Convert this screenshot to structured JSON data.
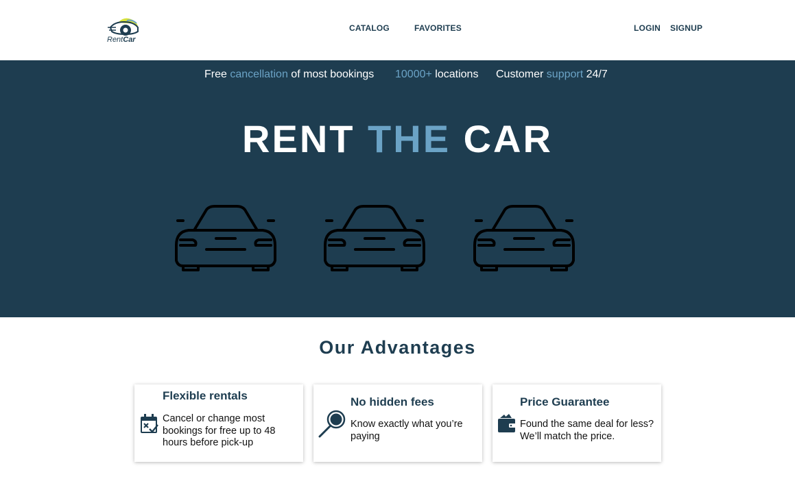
{
  "header": {
    "logo": {
      "text_regular": "Rent",
      "text_bold": "Car",
      "icon": "car-logo-icon"
    },
    "nav": {
      "catalog": "CATALOG",
      "favorites": "FAVORITES"
    },
    "auth": {
      "login": "LOGIN",
      "signup": "SIGNUP"
    }
  },
  "hero": {
    "promos": [
      {
        "before": "Free ",
        "accent": "cancellation",
        "after": " of most bookings"
      },
      {
        "before": "",
        "accent": "10000+",
        "after": " locations"
      },
      {
        "before": "Customer ",
        "accent": "support",
        "after": " 24/7"
      }
    ],
    "title": {
      "part1": "RENT ",
      "accent": "THE",
      "part2": " CAR"
    },
    "car_icons": [
      "car-front-icon",
      "car-front-icon",
      "car-front-icon"
    ]
  },
  "advantages": {
    "title": "Our Advantages",
    "cards": [
      {
        "title": "Flexible rentals",
        "description": "Cancel or change most bookings for free up to 48 hours before pick-up",
        "icon": "calendar-cancel-icon"
      },
      {
        "title": "No hidden fees",
        "description": "Know exactly what you’re paying",
        "icon": "magnifier-icon"
      },
      {
        "title": "Price Guarantee",
        "description": "Found the same deal for less? We’ll match the price.",
        "icon": "wallet-icon"
      }
    ]
  },
  "colors": {
    "primary": "#1e3d50",
    "accent": "#6ba3c6",
    "logo_yellow": "#d8e33a",
    "background": "#ffffff"
  }
}
